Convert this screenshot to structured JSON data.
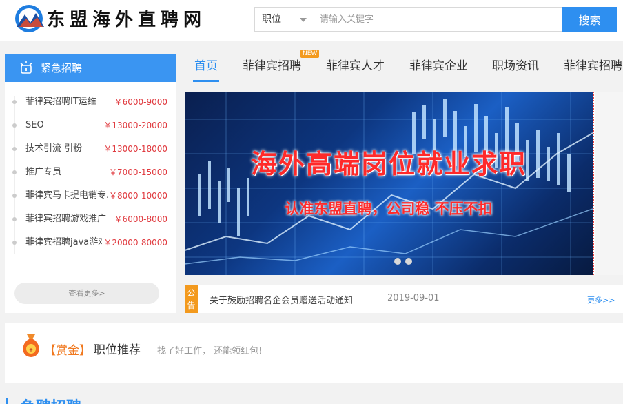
{
  "header": {
    "logo_text": "东盟海外直聘网",
    "search_select": "职位",
    "search_placeholder": "请输入关键字",
    "search_button": "搜索"
  },
  "urgent": {
    "title": "紧急招聘",
    "items": [
      {
        "name": "菲律宾招聘IT运维",
        "salary": "￥6000-9000"
      },
      {
        "name": "SEO",
        "salary": "￥13000-20000"
      },
      {
        "name": "技术引流 引粉",
        "salary": "￥13000-18000"
      },
      {
        "name": "推广专员",
        "salary": "￥7000-15000"
      },
      {
        "name": "菲律宾马卡提电销专...",
        "salary": "￥8000-10000"
      },
      {
        "name": "菲律宾招聘游戏推广",
        "salary": "￥6000-8000"
      },
      {
        "name": "菲律宾招聘java游戏...",
        "salary": "￥20000-80000"
      }
    ],
    "more_label": "查看更多>"
  },
  "nav": {
    "tabs": [
      "首页",
      "菲律宾招聘",
      "菲律宾人才",
      "菲律宾企业",
      "职场资讯",
      "菲律宾招聘"
    ],
    "new_badge": "NEW"
  },
  "banner": {
    "title": "海外高端岗位就业求职",
    "subtitle": "认准东盟直聘，公司稳 不压不扣"
  },
  "notice": {
    "tag": "公告",
    "text": "关于鼓励招聘名企会员赠送活动通知",
    "date": "2019-09-01",
    "more": "更多>>"
  },
  "reward": {
    "tag": "【赏金】",
    "title": "职位推荐",
    "subtitle": "找了好工作，   还能领红包!"
  },
  "next_section": {
    "title": "急聘招聘"
  },
  "colors": {
    "accent": "#2e8ff0",
    "salary": "#e0393e",
    "badge": "#f39a1e"
  }
}
